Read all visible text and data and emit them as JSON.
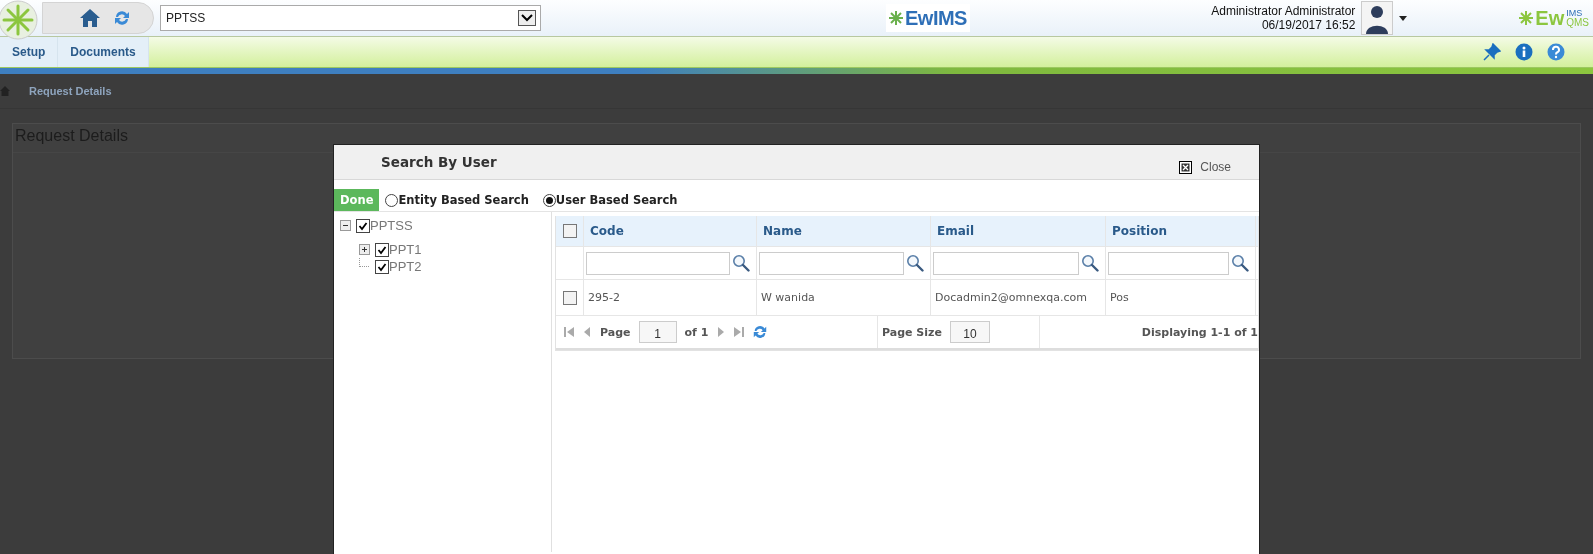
{
  "header": {
    "project_select": {
      "value": "PPTSS"
    },
    "logo": {
      "text": "EwIMS"
    },
    "user": {
      "name": "Administrator Administrator",
      "datetime": "06/19/2017 16:52"
    },
    "brand": {
      "text": "Ew",
      "sup": "IMS",
      "sub": "QMS"
    }
  },
  "nav": {
    "tabs": [
      {
        "label": "Setup"
      },
      {
        "label": "Documents"
      }
    ]
  },
  "breadcrumb": {
    "current": "Request Details"
  },
  "panel": {
    "title": "Request Details"
  },
  "dialog": {
    "title": "Search By User",
    "close": "Close",
    "done": "Done",
    "search_modes": [
      {
        "label": "Entity Based Search",
        "selected": false
      },
      {
        "label": "User Based Search",
        "selected": true
      }
    ],
    "tree": [
      {
        "label": "PPTSS",
        "checked": true,
        "kind": "branch",
        "expanded": true,
        "children": [
          {
            "label": "PPT1",
            "checked": true,
            "kind": "branch",
            "expanded": false
          },
          {
            "label": "PPT2",
            "checked": true,
            "kind": "leaf"
          }
        ]
      }
    ],
    "grid": {
      "header_checked": false,
      "columns": [
        "Code",
        "Name",
        "Email",
        "Position"
      ],
      "rows": [
        {
          "checked": false,
          "cells": [
            "295-2",
            "W wanida",
            "Docadmin2@omnexqa.com",
            "Pos"
          ]
        }
      ],
      "pager": {
        "page_label": "Page",
        "page": "1",
        "of": "of 1",
        "size_label": "Page Size",
        "size": "10",
        "display": "Displaying 1-1 of 1"
      }
    }
  }
}
